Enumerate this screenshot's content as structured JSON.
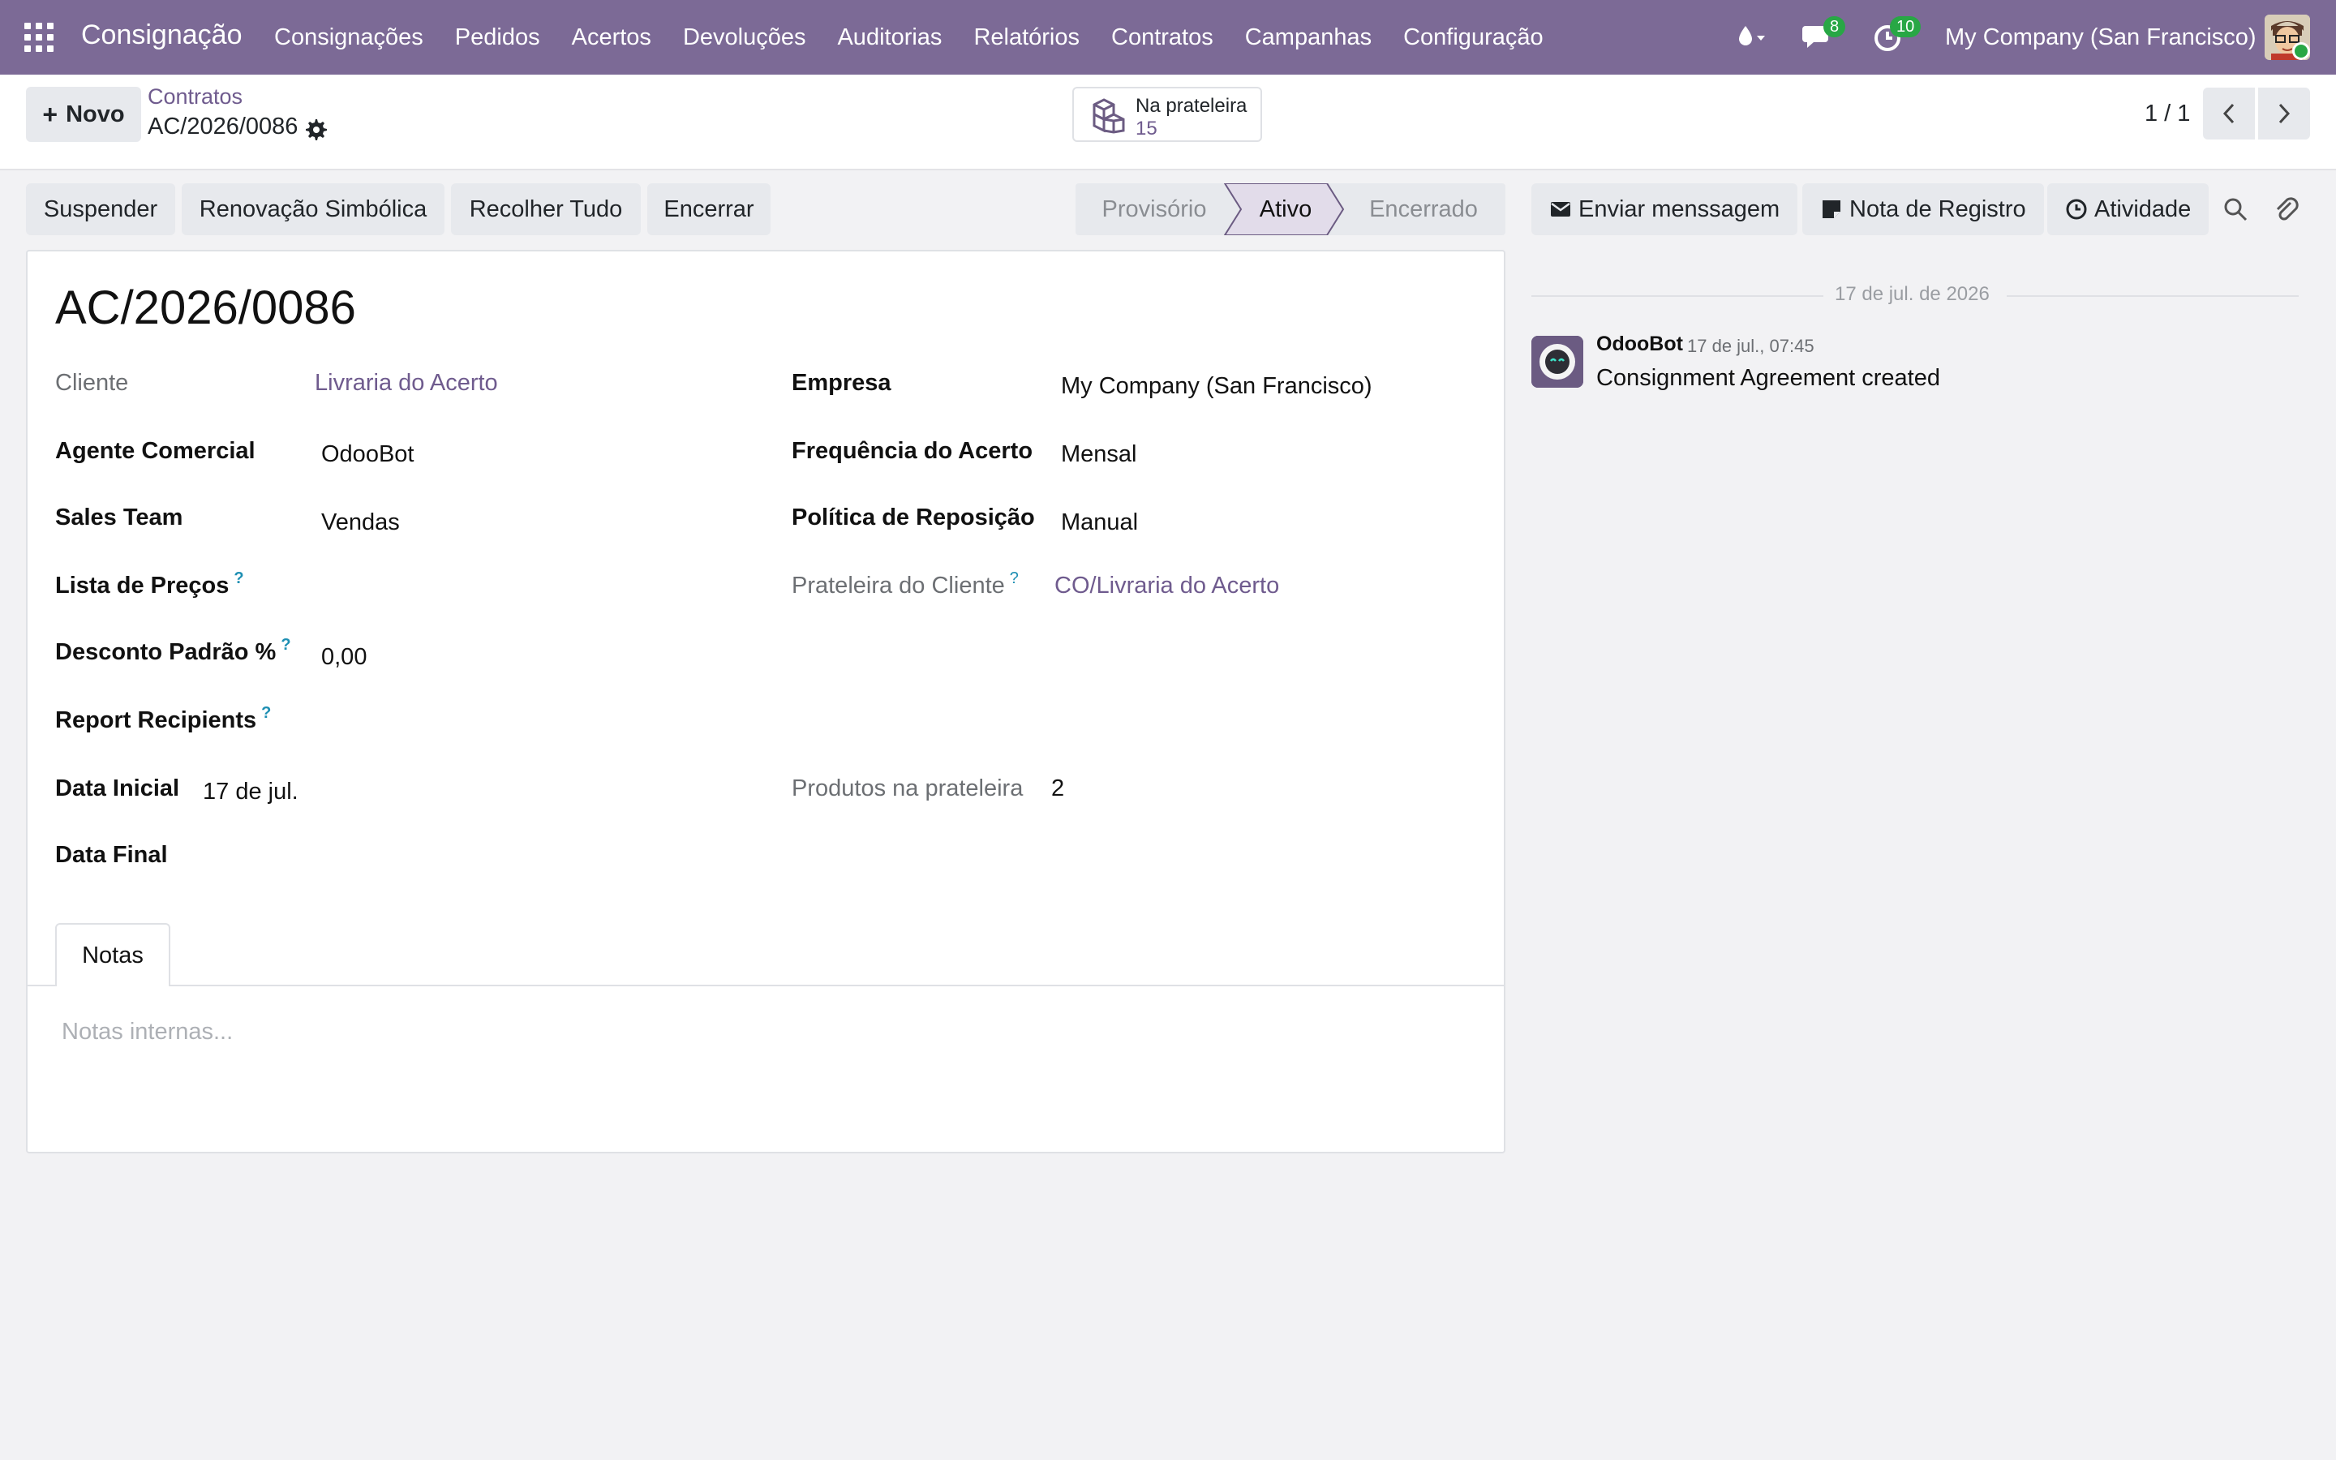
{
  "navbar": {
    "brand": "Consignação",
    "menu": [
      "Consignações",
      "Pedidos",
      "Acertos",
      "Devoluções",
      "Auditorias",
      "Relatórios",
      "Contratos",
      "Campanhas",
      "Configuração"
    ],
    "messages_badge": "8",
    "activities_badge": "10",
    "company": "My Company (San Francisco)",
    "color": "#7c6a96"
  },
  "control": {
    "new_label": "Novo",
    "breadcrumb_parent": "Contratos",
    "breadcrumb_current": "AC/2026/0086",
    "stat_label": "Na prateleira",
    "stat_value": "15",
    "pager": "1 / 1"
  },
  "actions": {
    "suspend": "Suspender",
    "renew": "Renovação Simbólica",
    "collect": "Recolher Tudo",
    "close": "Encerrar"
  },
  "stages": {
    "draft": "Provisório",
    "active": "Ativo",
    "closed": "Encerrado",
    "current": "Ativo"
  },
  "form": {
    "title": "AC/2026/0086",
    "left": {
      "client_label": "Cliente",
      "client_value": "Livraria do Acerto",
      "agent_label": "Agente Comercial",
      "agent_value": "OdooBot",
      "team_label": "Sales Team",
      "team_value": "Vendas",
      "pricelist_label": "Lista de Preços",
      "discount_label": "Desconto Padrão %",
      "discount_value": "0,00",
      "recipients_label": "Report Recipients",
      "start_label": "Data Inicial",
      "start_value": "17 de jul.",
      "end_label": "Data Final"
    },
    "right": {
      "company_label": "Empresa",
      "company_value": "My Company (San Francisco)",
      "frequency_label": "Frequência do Acerto",
      "frequency_value": "Mensal",
      "policy_label": "Política de Reposição",
      "policy_value": "Manual",
      "shelf_label": "Prateleira do Cliente",
      "shelf_value": "CO/Livraria do Acerto",
      "products_label": "Produtos na prateleira",
      "products_value": "2"
    },
    "tab_notes": "Notas",
    "notes_placeholder": "Notas internas..."
  },
  "chatter": {
    "send_message": "Enviar menssagem",
    "log_note": "Nota de Registro",
    "activity": "Atividade",
    "date_separator": "17 de jul. de 2026",
    "message": {
      "author": "OdooBot",
      "time": "17 de jul., 07:45",
      "body": "Consignment Agreement created"
    }
  }
}
